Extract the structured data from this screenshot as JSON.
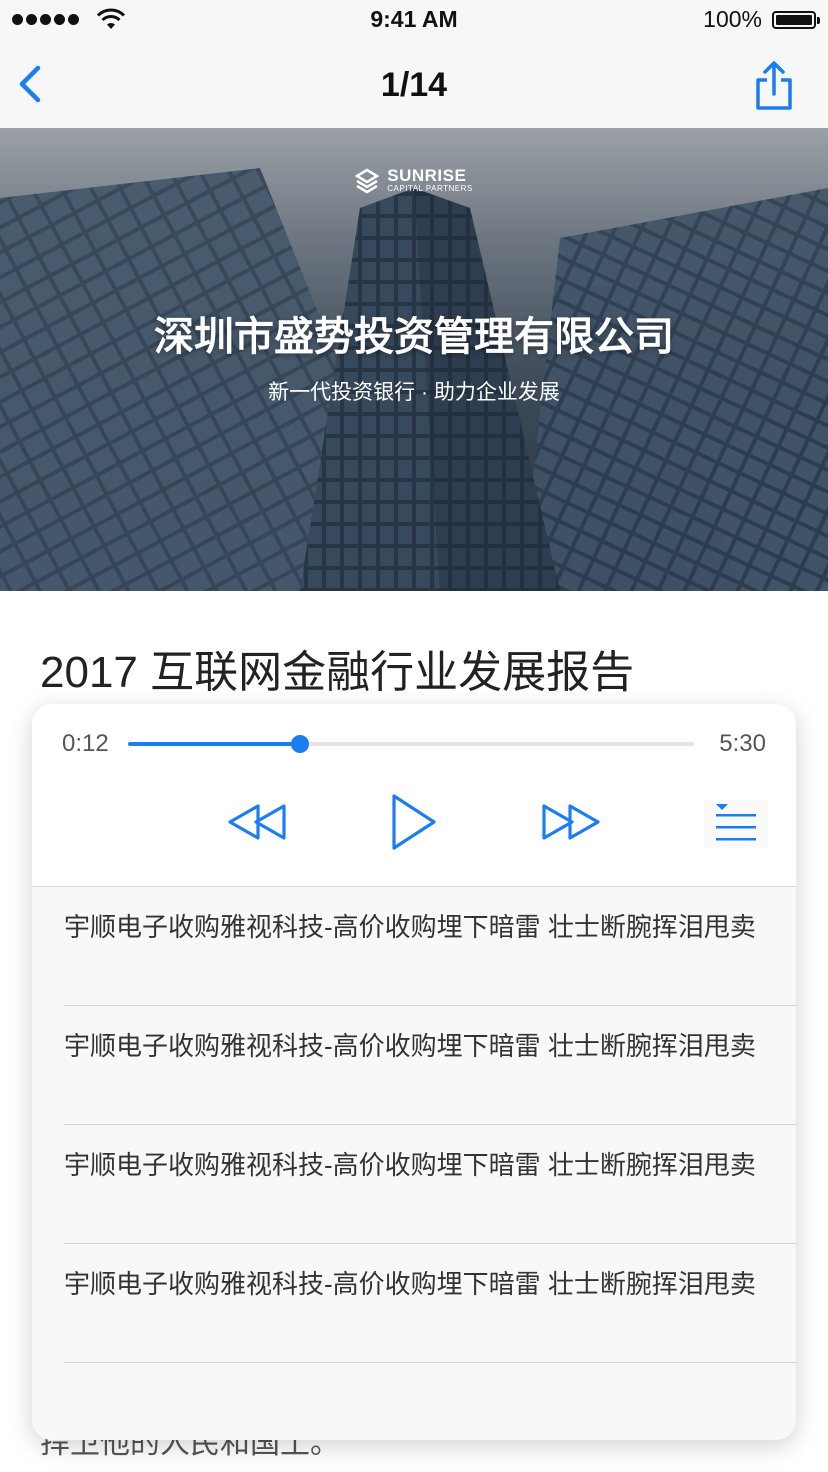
{
  "status": {
    "time": "9:41 AM",
    "battery": "100%"
  },
  "nav": {
    "title": "1/14"
  },
  "hero": {
    "brand_name": "SUNRISE",
    "brand_sub": "CAPITAL PARTNERS",
    "title": "深圳市盛势投资管理有限公司",
    "subtitle": "新一代投资银行 · 助力企业发展"
  },
  "article": {
    "title": "2017 互联网金融行业发展报告",
    "body_snippet": "捍卫他的人民和国土。"
  },
  "player": {
    "current_time": "0:12",
    "total_time": "5:30",
    "progress": 0.304,
    "accent": "#1a7ef0",
    "controls": [
      "rewind-icon",
      "play-icon",
      "fast-forward-icon",
      "playlist-icon"
    ]
  },
  "playlist": {
    "items": [
      {
        "title": "宇顺电子收购雅视科技-高价收购埋下暗雷 壮士断腕挥泪甩卖"
      },
      {
        "title": "宇顺电子收购雅视科技-高价收购埋下暗雷 壮士断腕挥泪甩卖"
      },
      {
        "title": "宇顺电子收购雅视科技-高价收购埋下暗雷 壮士断腕挥泪甩卖"
      },
      {
        "title": "宇顺电子收购雅视科技-高价收购埋下暗雷 壮士断腕挥泪甩卖"
      }
    ]
  }
}
